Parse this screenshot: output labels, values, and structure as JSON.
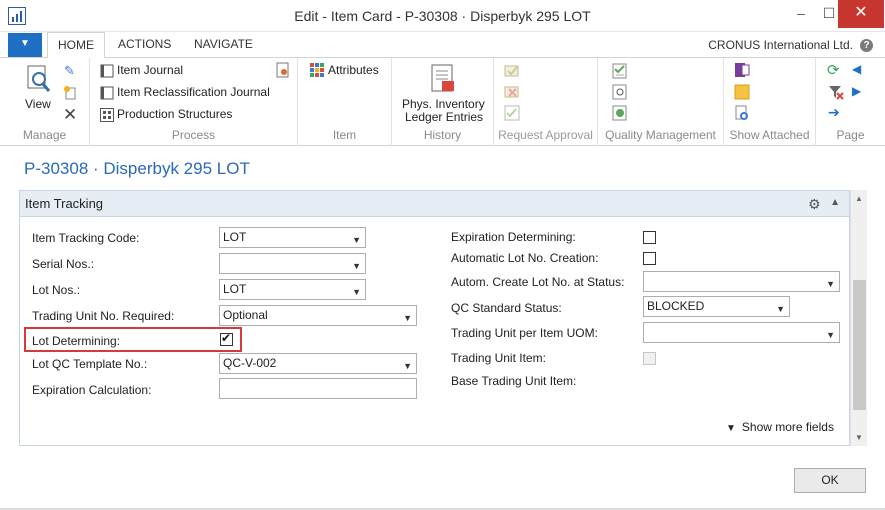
{
  "window": {
    "title": "Edit - Item Card - P-30308 · Disperbyk 295 LOT",
    "minimize": "–",
    "maximize": "☐",
    "close": "✕"
  },
  "ribbon_tabs": {
    "file_glyph": "▼",
    "home": "HOME",
    "actions": "ACTIONS",
    "navigate": "NAVIGATE",
    "company": "CRONUS International Ltd.",
    "help": "?"
  },
  "ribbon": {
    "manage": {
      "label": "Manage",
      "view": "View"
    },
    "process": {
      "label": "Process",
      "item_journal": "Item Journal",
      "item_reclass_journal": "Item Reclassification Journal",
      "production_structures": "Production Structures"
    },
    "item": {
      "label": "Item",
      "attributes": "Attributes"
    },
    "history": {
      "label": "History",
      "phys_inv_line1": "Phys. Inventory",
      "phys_inv_line2": "Ledger Entries"
    },
    "request_approval": {
      "label": "Request Approval"
    },
    "quality_management": {
      "label": "Quality Management"
    },
    "show_attached": {
      "label": "Show Attached"
    },
    "page": {
      "label": "Page"
    }
  },
  "page_title": "P-30308 · Disperbyk 295 LOT",
  "item_tracking": {
    "title": "Item Tracking",
    "left": {
      "item_tracking_code": {
        "label": "Item Tracking Code:",
        "value": "LOT"
      },
      "serial_nos": {
        "label": "Serial Nos.:",
        "value": ""
      },
      "lot_nos": {
        "label": "Lot Nos.:",
        "value": "LOT"
      },
      "trading_unit_no_required": {
        "label": "Trading Unit No. Required:",
        "value": "Optional"
      },
      "lot_determining": {
        "label": "Lot Determining:",
        "checked": true
      },
      "lot_qc_template_no": {
        "label": "Lot QC Template No.:",
        "value": "QC-V-002"
      },
      "expiration_calculation": {
        "label": "Expiration Calculation:",
        "value": ""
      }
    },
    "right": {
      "expiration_determining": {
        "label": "Expiration Determining:",
        "checked": false
      },
      "automatic_lot_no_creation": {
        "label": "Automatic Lot No. Creation:",
        "checked": false
      },
      "autom_create_lot_no_at_status": {
        "label": "Autom. Create Lot No. at Status:",
        "value": ""
      },
      "qc_standard_status": {
        "label": "QC Standard Status:",
        "value": "BLOCKED"
      },
      "trading_unit_per_item_uom": {
        "label": "Trading Unit per Item UOM:",
        "value": ""
      },
      "trading_unit_item": {
        "label": "Trading Unit Item:",
        "checked": false
      },
      "base_trading_unit_item": {
        "label": "Base Trading Unit Item:"
      }
    },
    "show_more": "Show more fields"
  },
  "ok_button": "OK",
  "colors": {
    "accent": "#1f6fc4",
    "title_blue": "#2a6ab6",
    "highlight_red": "#d43a3a",
    "panel_header": "#e6edf5"
  }
}
